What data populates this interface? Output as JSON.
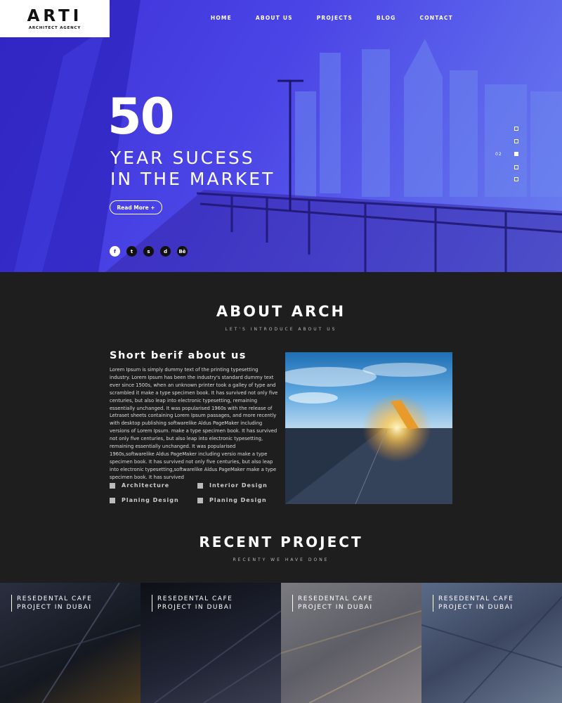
{
  "logo": {
    "title": "ARTI",
    "subtitle": "ARCHITECT AGENCY"
  },
  "nav": {
    "items": [
      "HOME",
      "ABOUT US",
      "PROJECTS",
      "BLOG",
      "CONTACT"
    ]
  },
  "hero": {
    "number": "50",
    "line1": "YEAR SUCESS",
    "line2": "IN THE MARKET",
    "button": "Read More +",
    "slide_number": "02",
    "slide_total_dots": 5,
    "active_slide": 2,
    "socials": [
      "f",
      "t",
      "s",
      "d",
      "Bē"
    ],
    "social_icons": [
      "facebook-icon",
      "twitter-icon",
      "skype-icon",
      "dribbble-icon",
      "behance-icon"
    ]
  },
  "about": {
    "title": "ABOUT ARCH",
    "subtitle": "LET'S INTRODUCE ABOUT US",
    "brief_title": "Short berif about us",
    "brief_text": "Lorem Ipsum is simply dummy text of the printing typesetting industry. Lorem Ipsum has been the industry's standard dummy text ever since 1500s, when an unknown printer took a galley of type and scrambled it make a type specimen book. It has survived not only five centuries, but also  leap into electronic typesetting, remaining essentially unchanged. It was popularised  1960s with the release of Letraset sheets containing Lorem Ipsum passages, and more recently with desktop publishing softwarelike Aldus PageMaker including versions of Lorem Ipsum. make a type specimen book. It has survived not only five centuries, but also  leap into electronic typesetting, remaining essentially unchanged. It was popularised  1960s,softwarelike Aldus PageMaker including versio make a type specimen book. It has survived not only five centuries, but also  leap into electronic typesetting,softwarelike Aldus PageMaker make a type specimen book. It has survived",
    "features": [
      "Architecture",
      "Interior Design",
      "Planing Design",
      "Planing Design"
    ]
  },
  "recent": {
    "title": "RECENT PROJECT",
    "subtitle": "RECENTY WE HAVE DONE",
    "projects": [
      {
        "line1": "RESEDENTAL CAFE",
        "line2": "PROJECT IN DUBAI"
      },
      {
        "line1": "RESEDENTAL CAFE",
        "line2": "PROJECT IN DUBAI"
      },
      {
        "line1": "RESEDENTAL CAFE",
        "line2": "PROJECT IN DUBAI"
      },
      {
        "line1": "RESEDENTAL CAFE",
        "line2": "PROJECT IN DUBAI"
      }
    ]
  },
  "colors": {
    "hero_primary": "#3d2fd6",
    "hero_secondary": "#6b7ff0",
    "dark_bg": "#1e1e1e",
    "white": "#ffffff"
  }
}
